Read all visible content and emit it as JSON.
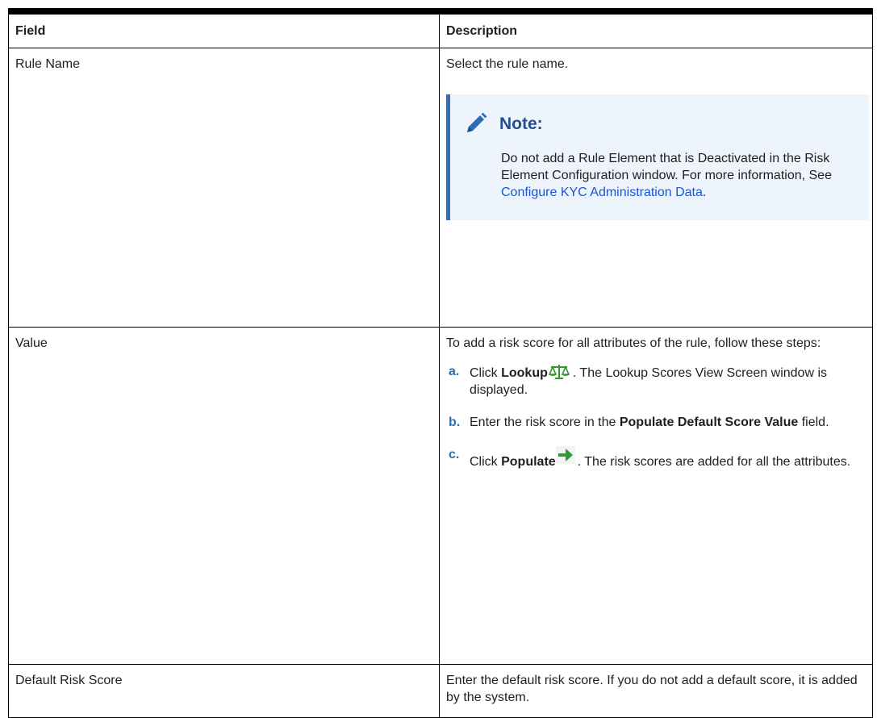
{
  "table": {
    "headers": {
      "field": "Field",
      "description": "Description"
    },
    "rows": {
      "rule_name": {
        "field": "Rule Name",
        "description": "Select the rule name.",
        "note": {
          "title": "Note:",
          "text": "Do not add a Rule Element that is Deactivated in the Risk Element Configuration window. For more information, See ",
          "link_text": "Configure KYC Administration Data",
          "text_after": "."
        }
      },
      "value": {
        "field": "Value",
        "intro": "To add a risk score for all attributes of the rule, follow these steps:",
        "steps": [
          {
            "letter": "a.",
            "pre": "Click ",
            "bold": "Lookup",
            "post": ". The Lookup Scores View Screen window is displayed.",
            "icon": "scales-icon"
          },
          {
            "letter": "b.",
            "pre": "Enter the risk score in the ",
            "bold": "Populate Default Score Value",
            "post": " field."
          },
          {
            "letter": "c.",
            "pre": "Click ",
            "bold": "Populate",
            "post": ". The risk scores are added for all the attributes.",
            "icon": "green-arrow-icon"
          }
        ]
      },
      "default_risk_score": {
        "field": "Default Risk Score",
        "description": "Enter the default risk score. If you do not add a default score, it is added by the system."
      }
    }
  },
  "colors": {
    "note_background": "#eef4fb",
    "note_accent": "#2f6db5",
    "note_title": "#1f4e92",
    "link": "#1a55d6",
    "step_letter": "#2f6db5",
    "icon_green": "#2e9b2e"
  }
}
